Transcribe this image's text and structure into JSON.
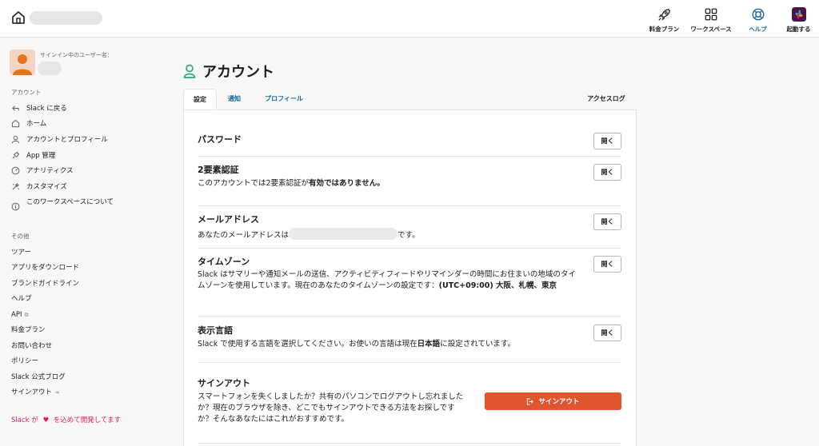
{
  "topnav": {
    "items": [
      {
        "label": "料金プラン",
        "icon": "rocket-icon"
      },
      {
        "label": "ワークスペース",
        "icon": "grid-icon"
      },
      {
        "label": "ヘルプ",
        "icon": "lifebuoy-icon"
      },
      {
        "label": "起動する",
        "icon": "slack-logo-icon"
      }
    ]
  },
  "sidebar": {
    "user_caption": "サインイン中のユーザー名：",
    "account_title": "アカウント",
    "account_items": [
      {
        "label": "Slack に戻る",
        "icon": "arrow-back-icon"
      },
      {
        "label": "ホーム",
        "icon": "home-icon"
      },
      {
        "label": "アカウントとプロフィール",
        "icon": "user-icon"
      },
      {
        "label": "App 管理",
        "icon": "plug-icon"
      },
      {
        "label": "アナリティクス",
        "icon": "gauge-icon"
      },
      {
        "label": "カスタマイズ",
        "icon": "palette-icon"
      },
      {
        "label": "このワークスペースについて",
        "icon": "info-icon"
      }
    ],
    "other_title": "その他",
    "other_items": [
      {
        "label": "ツアー"
      },
      {
        "label": "アプリをダウンロード"
      },
      {
        "label": "ブランドガイドライン"
      },
      {
        "label": "ヘルプ"
      },
      {
        "label": "API"
      },
      {
        "label": "料金プラン"
      },
      {
        "label": "お問い合わせ"
      },
      {
        "label": "ポリシー"
      },
      {
        "label": "Slack 公式ブログ"
      },
      {
        "label": "サインアウト"
      }
    ],
    "made_with_before": "Slack が",
    "made_with_after": "を込めて開発してます"
  },
  "page": {
    "title": "アカウント",
    "tabs": [
      {
        "label": "設定"
      },
      {
        "label": "通知"
      },
      {
        "label": "プロフィール"
      },
      {
        "label": "アクセスログ"
      }
    ]
  },
  "settings": {
    "open_label": "開く",
    "password": {
      "title": "パスワード"
    },
    "two_factor": {
      "title": "2要素認証",
      "desc_before": "このアカウントでは2要素認証が",
      "desc_bold": "有効ではありません。"
    },
    "email": {
      "title": "メールアドレス",
      "desc_before": "あなたのメールアドレスは",
      "desc_after": "です。"
    },
    "timezone": {
      "title": "タイムゾーン",
      "desc": "Slack はサマリーや通知メールの送信、アクティビティフィードやリマインダーの時間にお住まいの地域のタイムゾーンを使用しています。現在のあなたのタイムゾーンの設定です：",
      "desc_bold": "(UTC+09:00) 大阪、札幌、東京"
    },
    "language": {
      "title": "表示言語",
      "desc_before": "Slack で使用する言語を選択してください。お使いの言語は現在",
      "desc_bold": "日本語",
      "desc_after": "に設定されています。"
    },
    "signout": {
      "title": "サインアウト",
      "desc": "スマートフォンを失くしましたか？共有のパソコンでログアウトし忘れましたか？現在のブラウザを除き、どこでもサインアウトできる方法をお探しですか？そんなあなたにはこれがおすすめです。",
      "button_label": "サインアウト"
    }
  },
  "colors": {
    "link": "#1264a3",
    "signout_button": "#e0552d",
    "love_text": "#e01e5a",
    "account_icon": "#2bac76"
  }
}
